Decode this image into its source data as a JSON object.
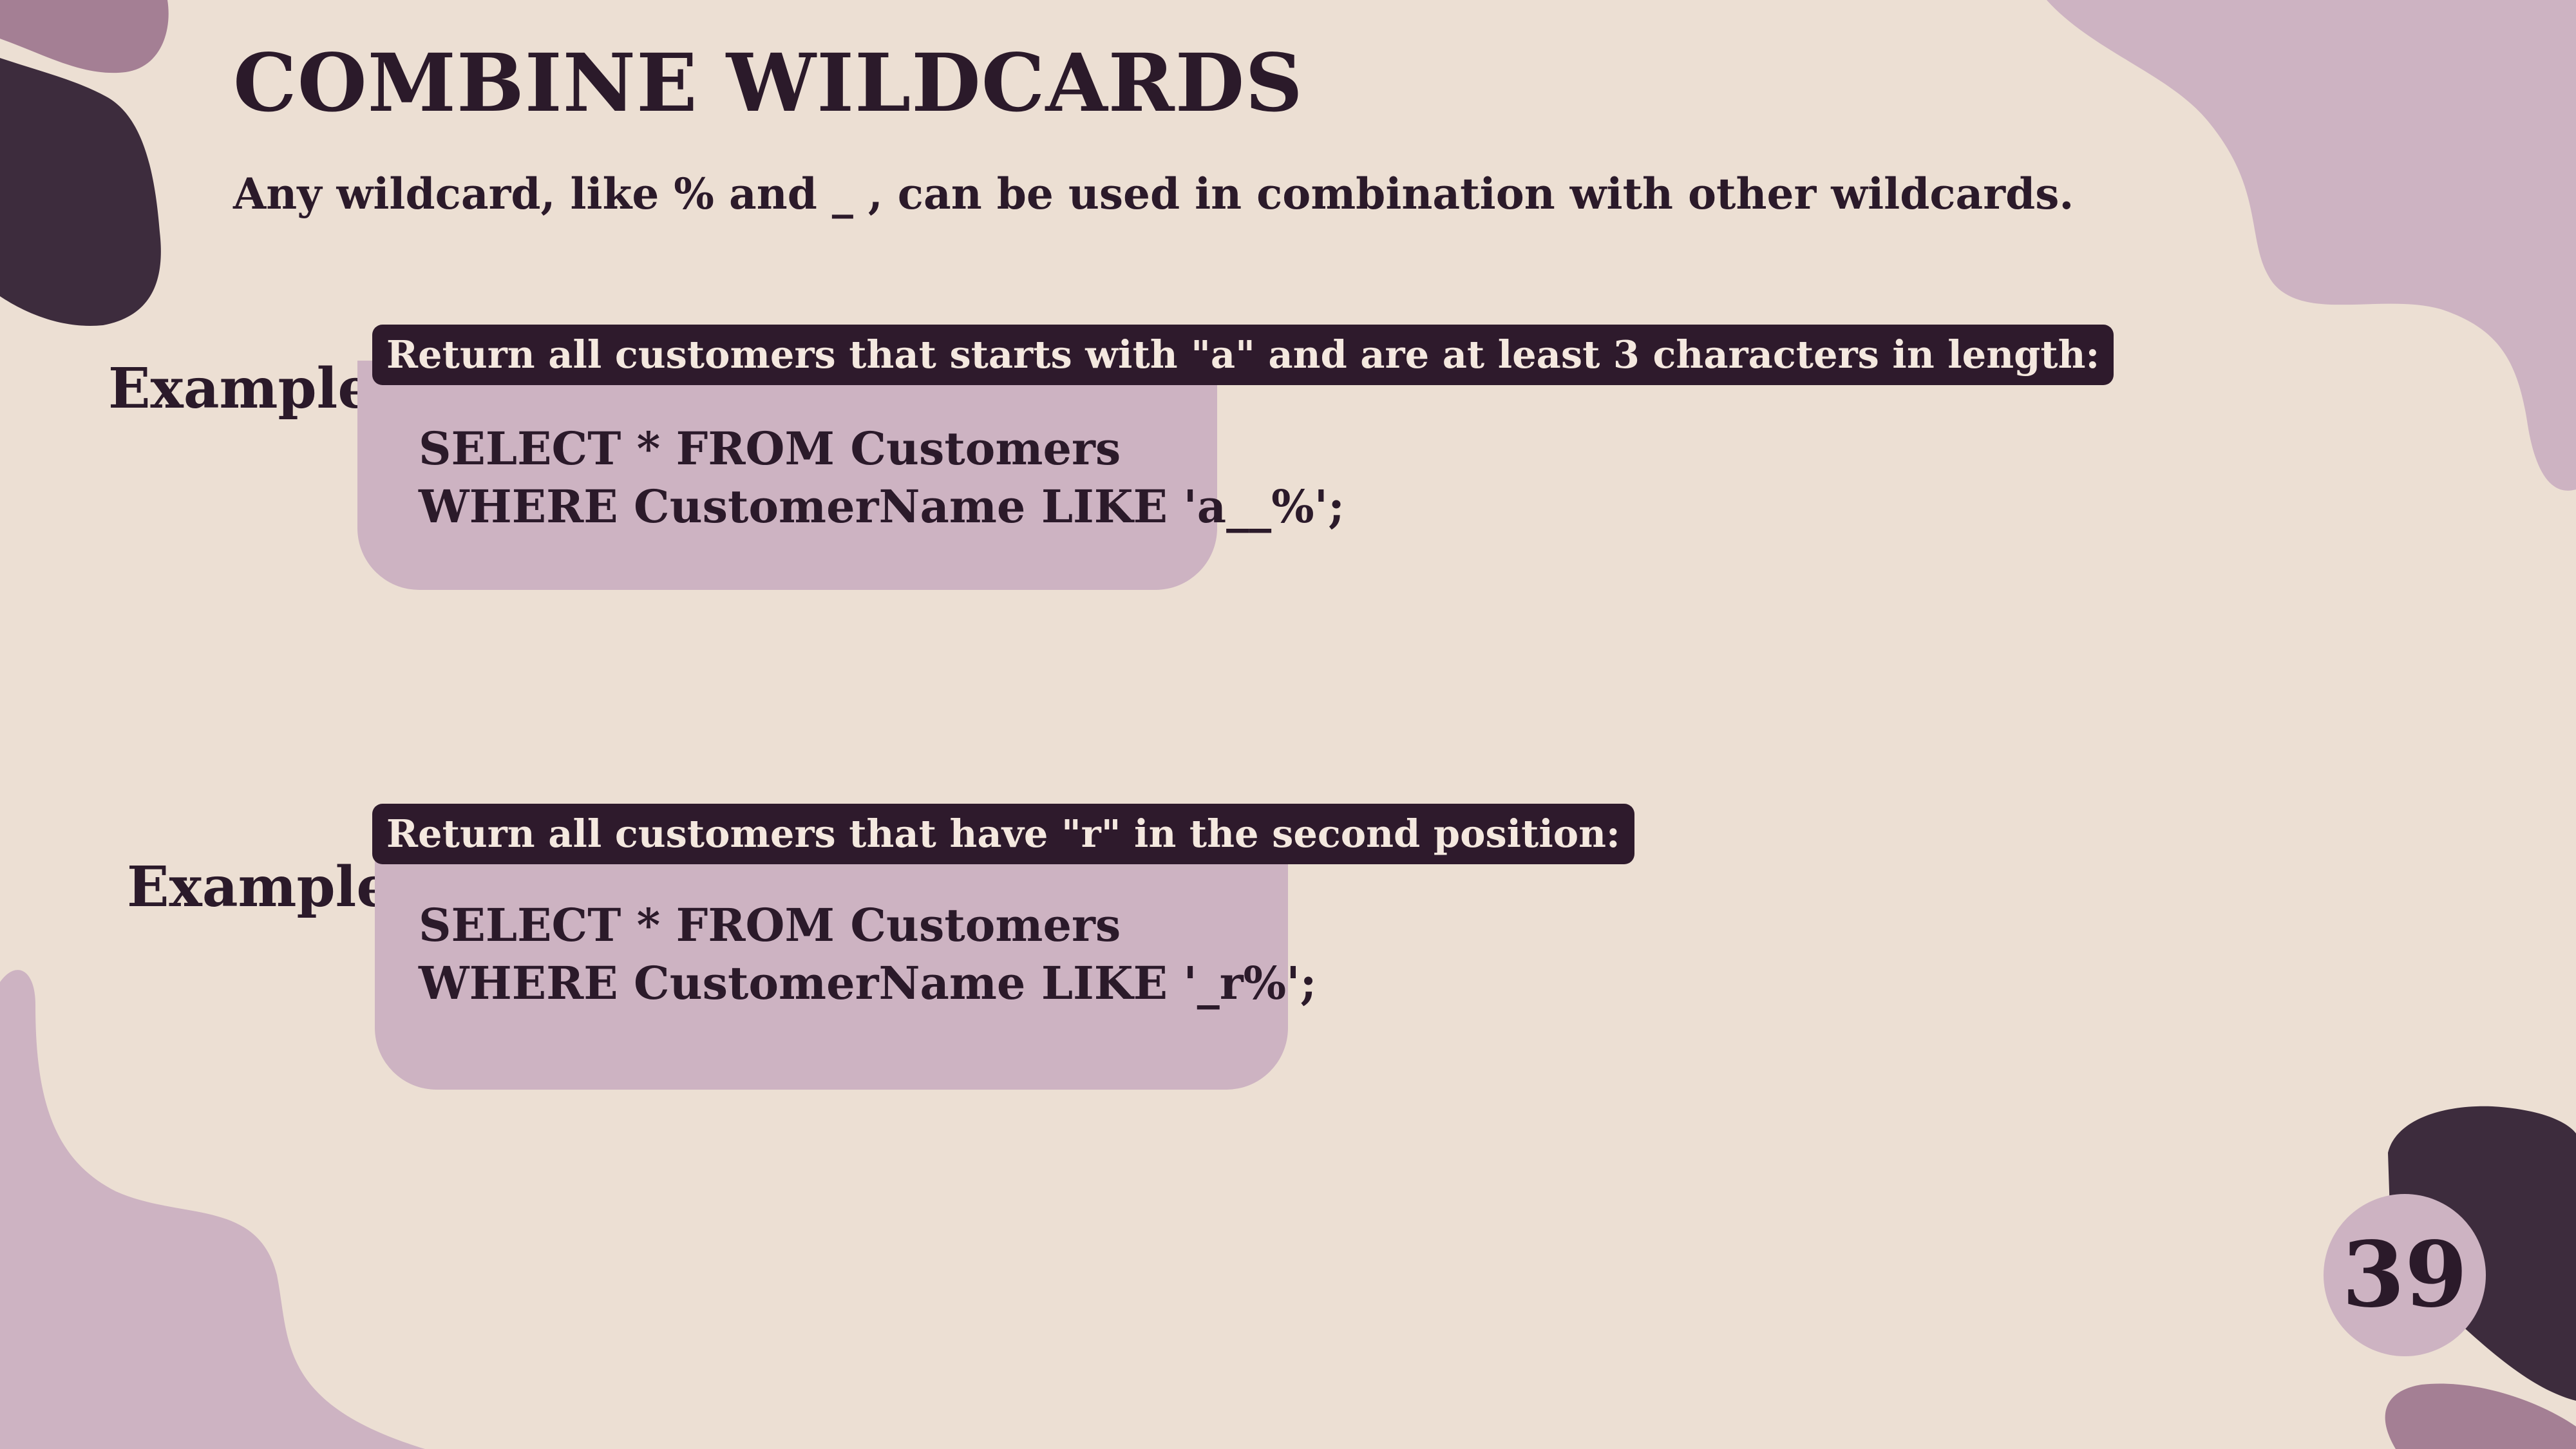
{
  "slide": {
    "title": "COMBINE WILDCARDS",
    "subtitle": "Any wildcard, like % and _ , can be used in combination with other wildcards.",
    "page_number": "39"
  },
  "examples": [
    {
      "label": "Example:",
      "banner": "Return all customers that starts with \"a\" and are at least 3 characters in length:",
      "code": [
        "SELECT * FROM Customers",
        "WHERE CustomerName LIKE 'a__%';"
      ]
    },
    {
      "label": "Example:",
      "banner": "Return all customers that have \"r\" in the second position:",
      "code": [
        "SELECT * FROM Customers",
        "WHERE CustomerName LIKE '_r%';"
      ]
    }
  ],
  "colors": {
    "background": "#ecdfd3",
    "dark_plum": "#3d2c3d",
    "light_mauve": "#cdb3c2",
    "medium_mauve": "#a47f94",
    "banner_dark": "#2e1a2c"
  }
}
